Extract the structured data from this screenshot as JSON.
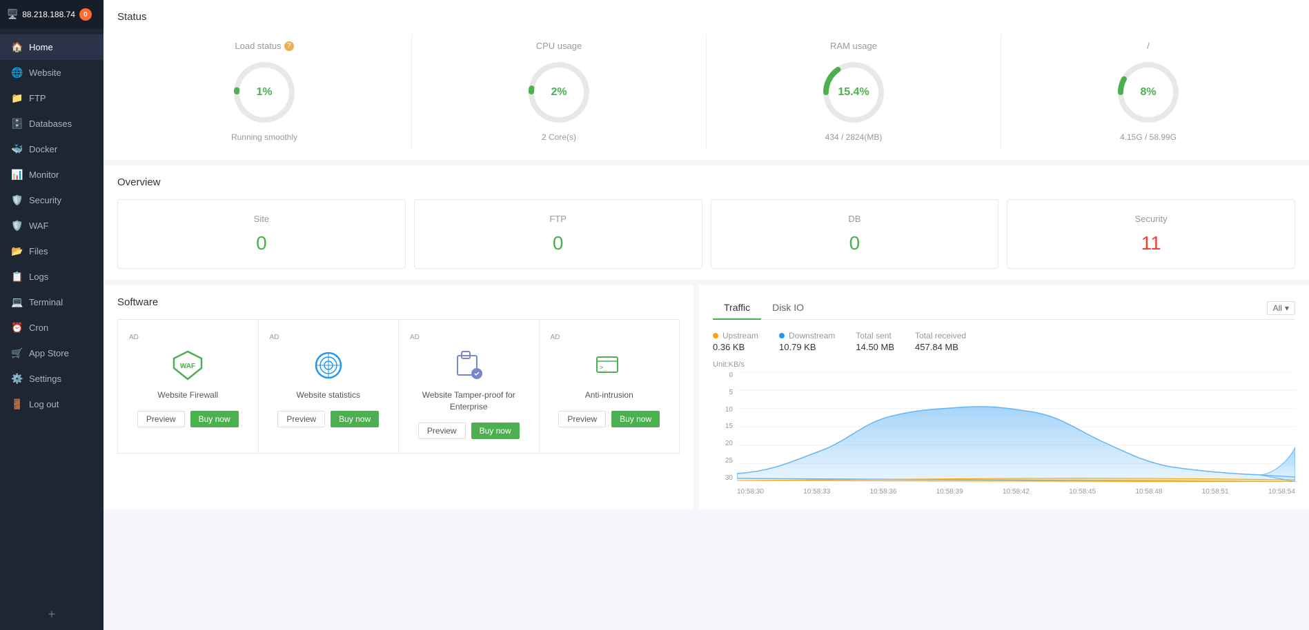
{
  "sidebar": {
    "ip": "88.218.188.74",
    "badge": "0",
    "items": [
      {
        "label": "Home",
        "icon": "🏠",
        "active": true
      },
      {
        "label": "Website",
        "icon": "🌐",
        "active": false
      },
      {
        "label": "FTP",
        "icon": "📁",
        "active": false
      },
      {
        "label": "Databases",
        "icon": "🗄️",
        "active": false
      },
      {
        "label": "Docker",
        "icon": "🐳",
        "active": false
      },
      {
        "label": "Monitor",
        "icon": "📊",
        "active": false
      },
      {
        "label": "Security",
        "icon": "🛡️",
        "active": false
      },
      {
        "label": "WAF",
        "icon": "🛡️",
        "active": false
      },
      {
        "label": "Files",
        "icon": "📂",
        "active": false
      },
      {
        "label": "Logs",
        "icon": "📋",
        "active": false
      },
      {
        "label": "Terminal",
        "icon": "💻",
        "active": false
      },
      {
        "label": "Cron",
        "icon": "⏰",
        "active": false
      },
      {
        "label": "App Store",
        "icon": "🛒",
        "active": false
      },
      {
        "label": "Settings",
        "icon": "⚙️",
        "active": false
      },
      {
        "label": "Log out",
        "icon": "🚪",
        "active": false
      }
    ],
    "add_label": "+"
  },
  "status": {
    "title": "Status",
    "gauges": [
      {
        "label": "Load status",
        "show_info": true,
        "value": "1%",
        "sublabel": "Running smoothly",
        "percent": 1,
        "color": "#4caf50"
      },
      {
        "label": "CPU usage",
        "show_info": false,
        "value": "2%",
        "sublabel": "2 Core(s)",
        "percent": 2,
        "color": "#4caf50"
      },
      {
        "label": "RAM usage",
        "show_info": false,
        "value": "15.4%",
        "sublabel": "434 / 2824(MB)",
        "percent": 15.4,
        "color": "#4caf50"
      },
      {
        "label": "/",
        "show_info": false,
        "value": "8%",
        "sublabel": "4.15G / 58.99G",
        "percent": 8,
        "color": "#4caf50"
      }
    ]
  },
  "overview": {
    "title": "Overview",
    "cards": [
      {
        "label": "Site",
        "value": "0",
        "color": "green"
      },
      {
        "label": "FTP",
        "value": "0",
        "color": "green"
      },
      {
        "label": "DB",
        "value": "0",
        "color": "green"
      },
      {
        "label": "Security",
        "value": "11",
        "color": "red"
      }
    ]
  },
  "software": {
    "title": "Software",
    "ads": [
      {
        "tag": "AD",
        "icon_type": "waf",
        "title": "Website Firewall",
        "btn_preview": "Preview",
        "btn_buy": "Buy now"
      },
      {
        "tag": "AD",
        "icon_type": "stats",
        "title": "Website statistics",
        "btn_preview": "Preview",
        "btn_buy": "Buy now"
      },
      {
        "tag": "AD",
        "icon_type": "tamper",
        "title": "Website Tamper-proof for Enterprise",
        "btn_preview": "Preview",
        "btn_buy": "Buy now"
      },
      {
        "tag": "AD",
        "icon_type": "antintrusion",
        "title": "Anti-intrusion",
        "btn_preview": "Preview",
        "btn_buy": "Buy now"
      }
    ]
  },
  "traffic": {
    "tabs": [
      {
        "label": "Traffic",
        "active": true
      },
      {
        "label": "Disk IO",
        "active": false
      }
    ],
    "filter": "All",
    "stats": [
      {
        "label": "Upstream",
        "dot": "orange",
        "value": "0.36 KB"
      },
      {
        "label": "Downstream",
        "dot": "blue",
        "value": "10.79 KB"
      },
      {
        "label": "Total sent",
        "dot": null,
        "value": "14.50 MB"
      },
      {
        "label": "Total received",
        "dot": null,
        "value": "457.84 MB"
      }
    ],
    "chart": {
      "unit": "Unit:KB/s",
      "y_labels": [
        "0",
        "5",
        "10",
        "15",
        "20",
        "25",
        "30"
      ],
      "x_labels": [
        "10:58:30",
        "10:58:33",
        "10:58:36",
        "10:58:39",
        "10:58:42",
        "10:58:45",
        "10:58:48",
        "10:58:51",
        "10:58:54"
      ]
    }
  }
}
